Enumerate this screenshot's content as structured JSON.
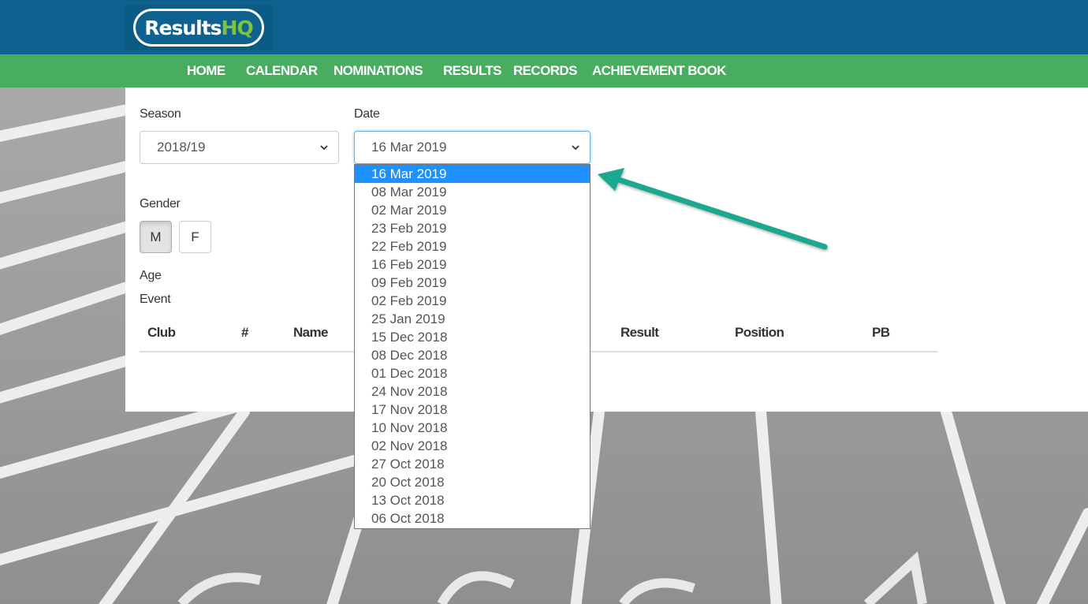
{
  "header": {
    "logo_main": "Results",
    "logo_accent": "HQ"
  },
  "nav": {
    "items": [
      "HOME",
      "CALENDAR",
      "NOMINATIONS",
      "RESULTS",
      "RECORDS",
      "ACHIEVEMENT BOOK"
    ]
  },
  "filters": {
    "season_label": "Season",
    "season_value": "2018/19",
    "date_label": "Date",
    "date_value": "16 Mar 2019",
    "gender_label": "Gender",
    "gender_options": [
      "M",
      "F"
    ],
    "gender_selected": "M",
    "age_label": "Age",
    "event_label": "Event"
  },
  "table": {
    "headers": [
      "Club",
      "#",
      "Name",
      "Result",
      "Position",
      "PB"
    ]
  },
  "date_dropdown": {
    "selected": "16 Mar 2019",
    "options": [
      "16 Mar 2019",
      "08 Mar 2019",
      "02 Mar 2019",
      "23 Feb 2019",
      "22 Feb 2019",
      "16 Feb 2019",
      "09 Feb 2019",
      "02 Feb 2019",
      "25 Jan 2019",
      "15 Dec 2018",
      "08 Dec 2018",
      "01 Dec 2018",
      "24 Nov 2018",
      "17 Nov 2018",
      "10 Nov 2018",
      "02 Nov 2018",
      "27 Oct 2018",
      "20 Oct 2018",
      "13 Oct 2018",
      "06 Oct 2018"
    ]
  },
  "colors": {
    "header_blue": "#0f628f",
    "nav_green": "#48ad5f",
    "selection_blue": "#1e90ff",
    "annotation_arrow": "#1aa88e"
  }
}
